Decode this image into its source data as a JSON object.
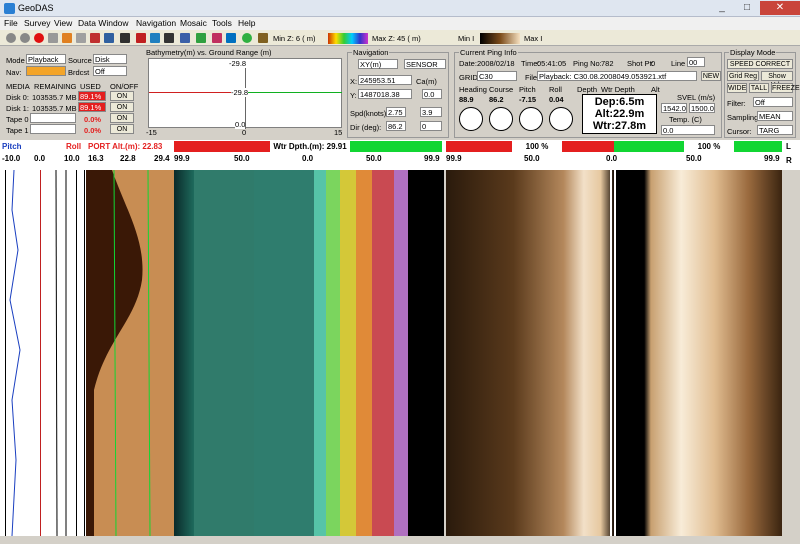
{
  "window": {
    "title": "GeoDAS",
    "min_label": "_",
    "max_label": "□",
    "close_label": "✕"
  },
  "menu": [
    "File",
    "Survey",
    "View",
    "Data Window",
    "Navigation",
    "Mosaic",
    "Tools",
    "Help"
  ],
  "toolbar": {
    "minz": "Min Z: 6 (  m)",
    "maxz": "Max Z: 45 (  m)",
    "mini": "Min I",
    "maxi": "Max I"
  },
  "source": {
    "mode_label": "Mode",
    "mode_value": "Playback",
    "source_label": "Source",
    "source_value": "Disk",
    "nav_label": "Nav:",
    "brdcst_label": "Brdcst",
    "brdcst_value": "Off"
  },
  "media": {
    "headers": [
      "MEDIA",
      "REMAINING",
      "USED",
      "ON/OFF"
    ],
    "rows": [
      {
        "name": "Disk 0:",
        "remaining": "103535.7 MB",
        "used": "89.1%",
        "state": "ON"
      },
      {
        "name": "Disk 1:",
        "remaining": "103535.7 MB",
        "used": "89.1%",
        "state": "ON"
      },
      {
        "name": "Tape 0",
        "remaining": "",
        "used": "0.0%",
        "state": "ON"
      },
      {
        "name": "Tape 1",
        "remaining": "",
        "used": "0.0%",
        "state": "ON"
      }
    ]
  },
  "bathy": {
    "title": "Bathymetry(m) vs. Ground Range (m)",
    "top_tick": "-29.8",
    "mid_tick": "-29.8",
    "bottom_tick": "0.0",
    "x_left": "-15",
    "x_mid": "0",
    "x_right": "15"
  },
  "navigation": {
    "title": "Navigation",
    "coord_sel": "XY(m)",
    "sensor_sel": "SENSOR",
    "x_label": "X:",
    "x_value": "245953.51",
    "y_label": "Y:",
    "y_value": "1487018.38",
    "calm_label": "Ca(m)",
    "calm_value": "0.0",
    "spd_label": "Spd(knots)",
    "spd_value": "2.75",
    "spd_set": "3.9",
    "dir_label": "Dir (deg):",
    "dir_value": "86.2",
    "dir_set": "0"
  },
  "ping": {
    "title": "Current Ping Info",
    "date_label": "Date:",
    "date_value": "2008/02/18",
    "time_label": "Time:",
    "time_value": "05:41:05",
    "pingno_label": "Ping No:",
    "pingno_value": "782",
    "shot_label": "Shot Pt:",
    "shot_value": "0",
    "line_label": "Line",
    "line_value": "00",
    "grid_label": "GRID",
    "grid_value": "C30",
    "file_label": "File",
    "file_value": "Playback: C30.08.2008049.053921.xtf",
    "new_label": "NEW",
    "heading_label": "Heading",
    "heading_value": "88.9",
    "course_label": "Course",
    "course_value": "86.2",
    "pitch_label": "Pitch",
    "pitch_value": "-7.15",
    "roll_label": "Roll",
    "roll_value": "0.04",
    "depth_label": "Depth",
    "wtr_label": "Wtr Depth",
    "alt_label": "Alt",
    "dep": "Dep:6.5m",
    "altv": "Alt:22.9m",
    "wtr": "Wtr:27.8m",
    "svel_label": "SVEL (m/s)",
    "svel_value": "1542.0",
    "svel_set": "1500.0",
    "temp_label": "Temp. (C)",
    "temp_value": "0.0"
  },
  "display": {
    "title": "Display Mode",
    "speed": "SPEED CORRECT",
    "grid": "Grid Reg",
    "show": "Show Hdn",
    "wide": "WIDE",
    "tall": "TALL",
    "freeze": "FREEZE",
    "filter_label": "Filter:",
    "filter_value": "Off",
    "sampling_label": "Sampling:",
    "sampling_value": "MEAN",
    "cursor_label": "Cursor:",
    "cursor_value": "TARG"
  },
  "status": {
    "pitch": "Pitch",
    "roll": "Roll",
    "port_alt": "PORT Alt.(m): 22.83",
    "wtr_depth": "Wtr Dpth.(m): 29.91",
    "pct_left": "100 %",
    "pct_right": "100 %",
    "l": "L",
    "r": "R",
    "pitch_ticks": [
      "-10.0",
      "0.0",
      "10.0"
    ],
    "alt_ticks": [
      "16.3",
      "22.8",
      "29.4"
    ],
    "bathy_ticks": [
      "99.9",
      "50.0",
      "0.0",
      "50.0",
      "99.9"
    ],
    "sss_ticks": [
      "99.9",
      "50.0",
      "0.0",
      "50.0",
      "99.9"
    ]
  },
  "colors": {
    "red": "#e41f1f",
    "green": "#11d633",
    "orange": "#f3a428"
  }
}
